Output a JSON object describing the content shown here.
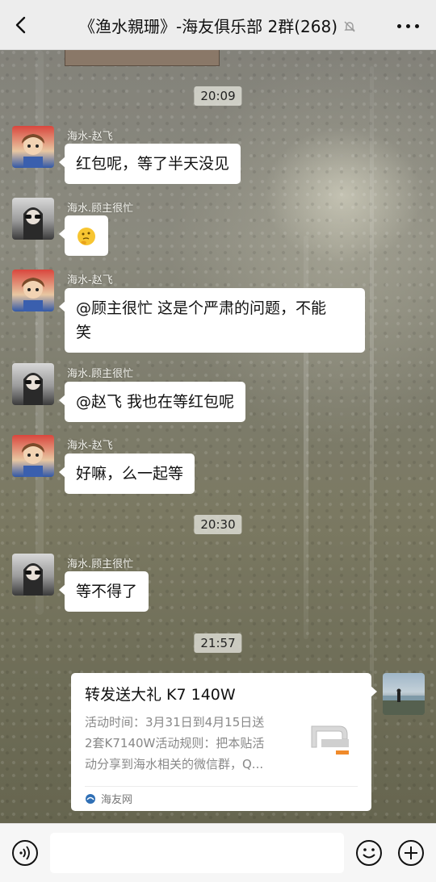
{
  "header": {
    "title": "《渔水親珊》-海友俱乐部 2群(268)",
    "back_icon": "chevron-left-icon",
    "mute_icon": "bell-off-icon",
    "more_icon": "more-dots-icon"
  },
  "messages": {
    "t1": "20:09",
    "m1": {
      "sender": "海水-赵飞",
      "text": "红包呢，等了半天没见"
    },
    "m2": {
      "sender": "海水.顾主很忙",
      "emoji": "thinking-face-emoji"
    },
    "m3": {
      "sender": "海水-赵飞",
      "line1": "@顾主很忙  这是个严肃的问题，不能",
      "line2": "笑"
    },
    "m4": {
      "sender": "海水.顾主很忙",
      "text": "@赵飞  我也在等红包呢"
    },
    "m5": {
      "sender": "海水-赵飞",
      "text": "好嘛，么一起等"
    },
    "t2": "20:30",
    "m6": {
      "sender": "海水.顾主很忙",
      "text": "等不得了"
    },
    "t3": "21:57",
    "card": {
      "title": "转发送大礼 K7 140W",
      "desc_line1": "活动时间：3月31日到4月15日送",
      "desc_line2": "2套K7140W活动规则：把本贴活",
      "desc_line3": "动分享到海水相关的微信群，Q...",
      "source": "海友网"
    }
  },
  "inputbar": {
    "voice_icon": "voice-icon",
    "emoji_icon": "smile-icon",
    "plus_icon": "plus-icon"
  },
  "colors": {
    "header_bg": "#ededed",
    "bubble_bg": "#ffffff",
    "timestamp_bg": "#dadad2"
  }
}
